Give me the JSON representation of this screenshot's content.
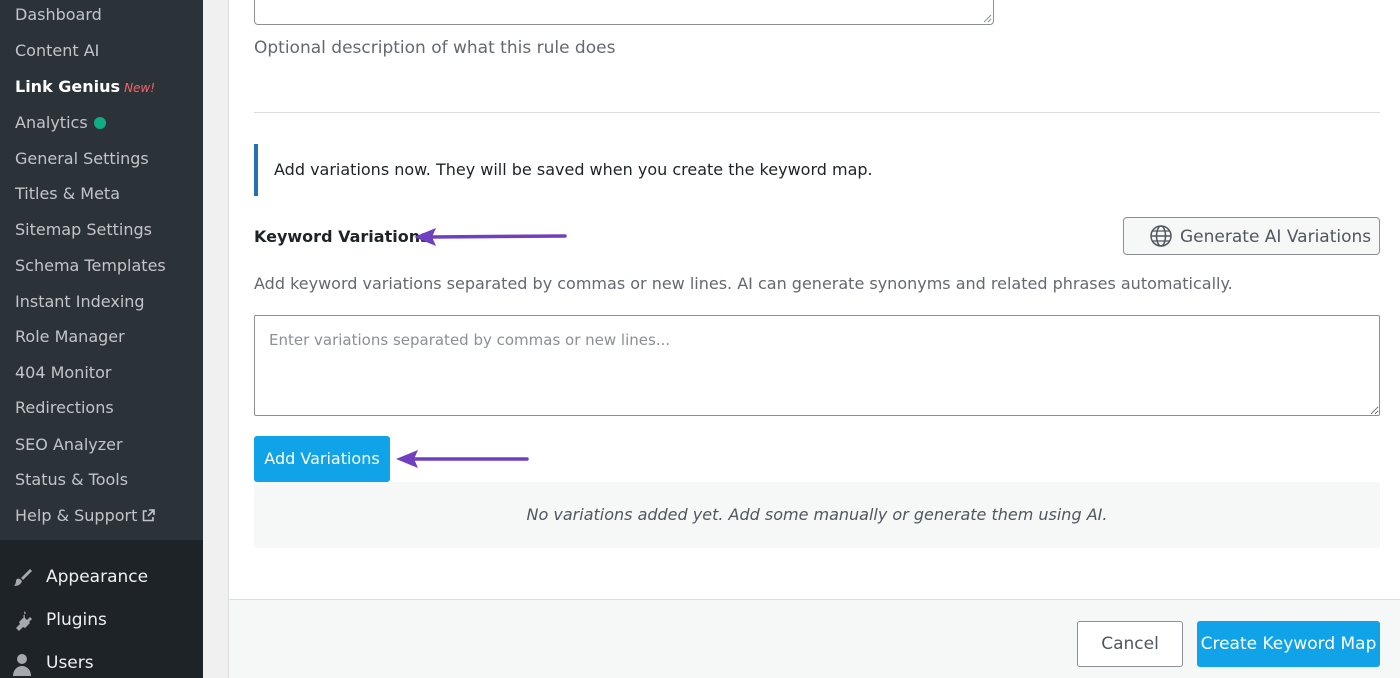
{
  "sidebar": {
    "submenu": [
      {
        "label": "Dashboard"
      },
      {
        "label": "Content AI"
      },
      {
        "label": "Link Genius",
        "badge": "New!",
        "current": true
      },
      {
        "label": "Analytics"
      },
      {
        "label": "General Settings"
      },
      {
        "label": "Titles & Meta"
      },
      {
        "label": "Sitemap Settings"
      },
      {
        "label": "Schema Templates"
      },
      {
        "label": "Instant Indexing"
      },
      {
        "label": "Role Manager"
      },
      {
        "label": "404 Monitor"
      },
      {
        "label": "Redirections"
      },
      {
        "label": "SEO Analyzer"
      },
      {
        "label": "Status & Tools"
      },
      {
        "label": "Help & Support"
      }
    ],
    "menu": [
      {
        "label": "Appearance",
        "icon": "paintbrush-icon"
      },
      {
        "label": "Plugins",
        "icon": "plugin-icon"
      },
      {
        "label": "Users",
        "icon": "user-icon"
      }
    ]
  },
  "form": {
    "description_hint": "Optional description of what this rule does",
    "notice": "Add variations now. They will be saved when you create the keyword map.",
    "variations_title": "Keyword Variations",
    "generate_button": "Generate AI Variations",
    "variations_description": "Add keyword variations separated by commas or new lines. AI can generate synonyms and related phrases automatically.",
    "variations_placeholder": "Enter variations separated by commas or new lines...",
    "variations_value": "",
    "add_button": "Add Variations",
    "empty_state": "No variations added yet. Add some manually or generate them using AI."
  },
  "footer": {
    "cancel_label": "Cancel",
    "create_label": "Create Keyword Map"
  },
  "colors": {
    "sidebar_bg": "#1d2327",
    "submenu_bg": "#2c3338",
    "accent_button": "#10a3e8",
    "notice_border": "#2271b1",
    "annotation_arrow": "#6f3fbf",
    "new_badge": "#f86368",
    "status_dot": "#10ac84"
  }
}
